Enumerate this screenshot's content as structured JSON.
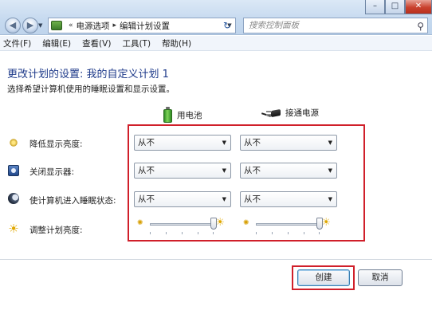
{
  "window": {
    "breadcrumb": [
      "电源选项",
      "编辑计划设置"
    ],
    "search_placeholder": "搜索控制面板",
    "controls": {
      "minimize": "–",
      "maximize": "□",
      "close": "✕"
    }
  },
  "menu": [
    "文件(F)",
    "编辑(E)",
    "查看(V)",
    "工具(T)",
    "帮助(H)"
  ],
  "page": {
    "heading": "更改计划的设置: 我的自定义计划 1",
    "subtitle": "选择希望计算机使用的睡眠设置和显示设置。",
    "columns": {
      "battery": "用电池",
      "plugged_in": "接通电源"
    }
  },
  "settings": [
    {
      "label": "降低显示亮度:",
      "icon": "dim-display-icon",
      "battery": "从不",
      "plugged_in": "从不"
    },
    {
      "label": "关闭显示器:",
      "icon": "monitor-off-icon",
      "battery": "从不",
      "plugged_in": "从不"
    },
    {
      "label": "使计算机进入睡眠状态:",
      "icon": "sleep-moon-icon",
      "battery": "从不",
      "plugged_in": "从不"
    },
    {
      "label": "调整计划亮度:",
      "icon": "brightness-sun-icon",
      "battery_brightness_pct": 100,
      "plugged_in_brightness_pct": 100
    }
  ],
  "buttons": {
    "create": "创建",
    "cancel": "取消"
  },
  "colors": {
    "highlight": "#d01f2a",
    "heading": "#1e3a8a"
  }
}
